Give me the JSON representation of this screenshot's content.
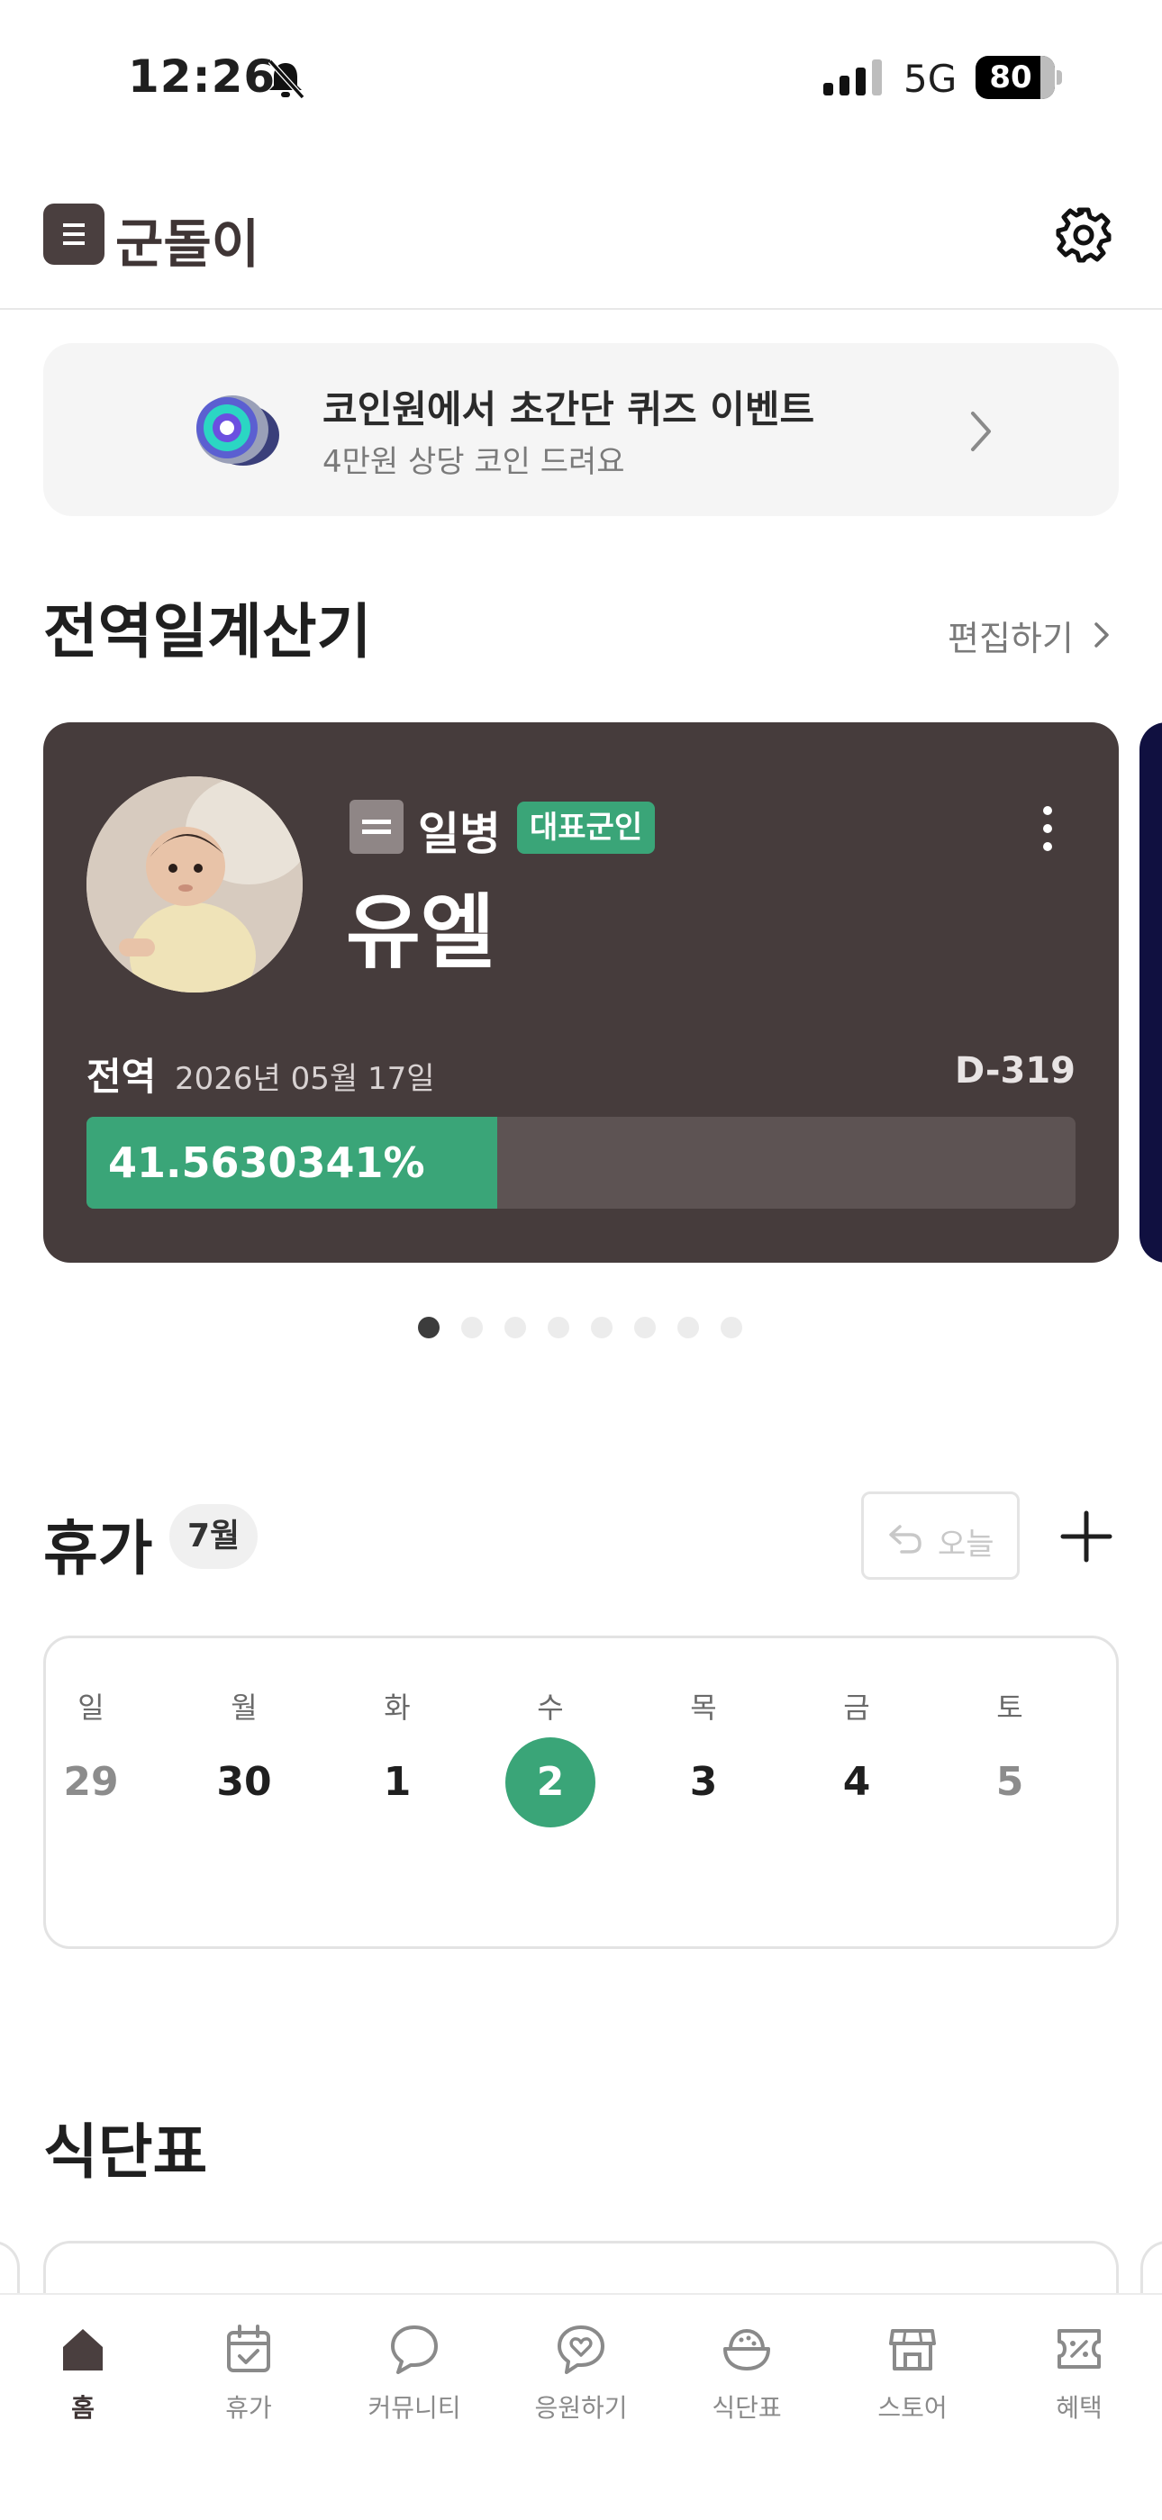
{
  "status_bar": {
    "time": "12:26",
    "network": "5G",
    "battery": "80"
  },
  "header": {
    "title": "군돌이"
  },
  "promo": {
    "title": "코인원에서 초간단 퀴즈 이벤트",
    "subtitle": "4만원 상당 코인 드려요"
  },
  "calculator": {
    "section_title": "전역일계산기",
    "edit_label": "편집하기",
    "card": {
      "rank": "일병",
      "badge": "대표군인",
      "name": "유엘",
      "discharge_label": "전역",
      "discharge_date": "2026년 05월 17일",
      "d_day": "D-319",
      "progress_percent": 41.5630341,
      "progress_label": "41.5630341%"
    },
    "pagination": {
      "count": 8,
      "active_index": 0
    }
  },
  "vacation": {
    "section_title": "휴가",
    "month": "7월",
    "today_button": "오늘",
    "days": [
      {
        "weekday": "일",
        "date": "29",
        "muted": true,
        "selected": false
      },
      {
        "weekday": "월",
        "date": "30",
        "muted": false,
        "selected": false
      },
      {
        "weekday": "화",
        "date": "1",
        "muted": false,
        "selected": false
      },
      {
        "weekday": "수",
        "date": "2",
        "muted": false,
        "selected": true
      },
      {
        "weekday": "목",
        "date": "3",
        "muted": false,
        "selected": false
      },
      {
        "weekday": "금",
        "date": "4",
        "muted": false,
        "selected": false
      },
      {
        "weekday": "토",
        "date": "5",
        "muted": true,
        "selected": false
      }
    ]
  },
  "meal": {
    "section_title": "식단표"
  },
  "tabbar": {
    "items": [
      {
        "label": "홈",
        "icon": "home-icon",
        "active": true
      },
      {
        "label": "휴가",
        "icon": "calendar-check-icon",
        "active": false
      },
      {
        "label": "커뮤니티",
        "icon": "chat-bubble-icon",
        "active": false
      },
      {
        "label": "응원하기",
        "icon": "heart-bubble-icon",
        "active": false
      },
      {
        "label": "식단표",
        "icon": "rice-bowl-icon",
        "active": false
      },
      {
        "label": "스토어",
        "icon": "store-icon",
        "active": false
      },
      {
        "label": "혜택",
        "icon": "coupon-icon",
        "active": false
      }
    ]
  },
  "colors": {
    "accent": "#3aa578",
    "card": "#463c3c",
    "brand_dark": "#4a3f3f"
  }
}
